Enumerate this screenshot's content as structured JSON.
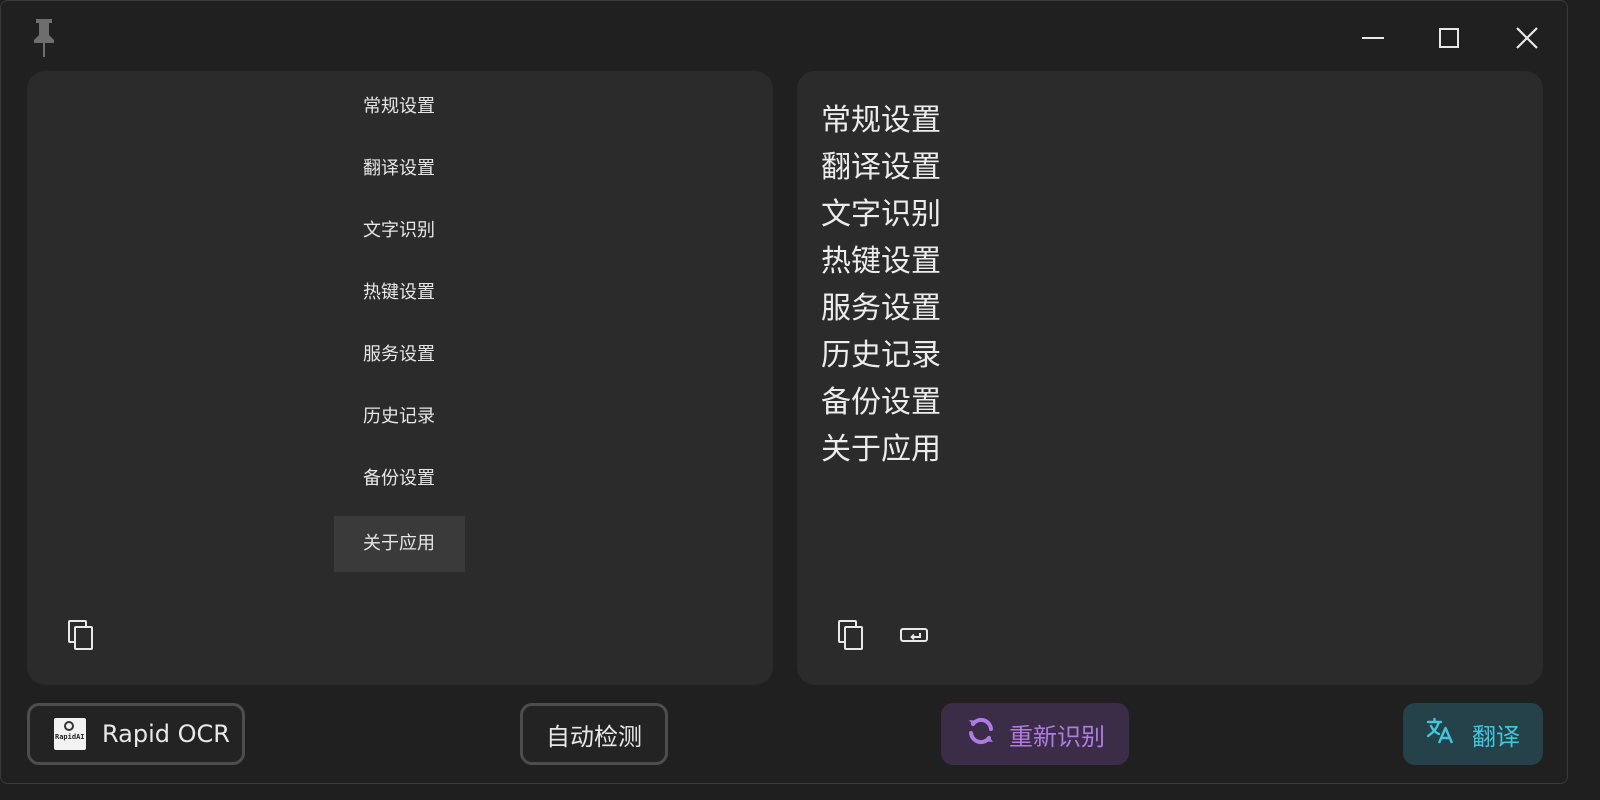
{
  "titlebar": {
    "pin_icon": "pin-icon",
    "controls": [
      "minimize-icon",
      "maximize-icon",
      "close-icon"
    ]
  },
  "source_panel": {
    "items": [
      "常规设置",
      "翻译设置",
      "文字识别",
      "热键设置",
      "服务设置",
      "历史记录",
      "备份设置",
      "关于应用"
    ],
    "active_index": 7,
    "copy_icon": "copy-icon"
  },
  "result_panel": {
    "lines": [
      "常规设置",
      "翻译设置",
      "文字识别",
      "热键设置",
      "服务设置",
      "历史记录",
      "备份设置",
      "关于应用"
    ],
    "copy_icon": "copy-icon",
    "delete_newline_icon": "keyboard-return-icon"
  },
  "bottom_bar": {
    "engine_label": "Rapid OCR",
    "engine_logo_text": "RapidAI",
    "language_label": "自动检测",
    "recognize_label": "重新识别",
    "translate_label": "翻译"
  },
  "colors": {
    "recognize_bg": "#3b2d48",
    "recognize_fg": "#b07be0",
    "translate_bg": "#25414a",
    "translate_fg": "#41c6dc"
  }
}
